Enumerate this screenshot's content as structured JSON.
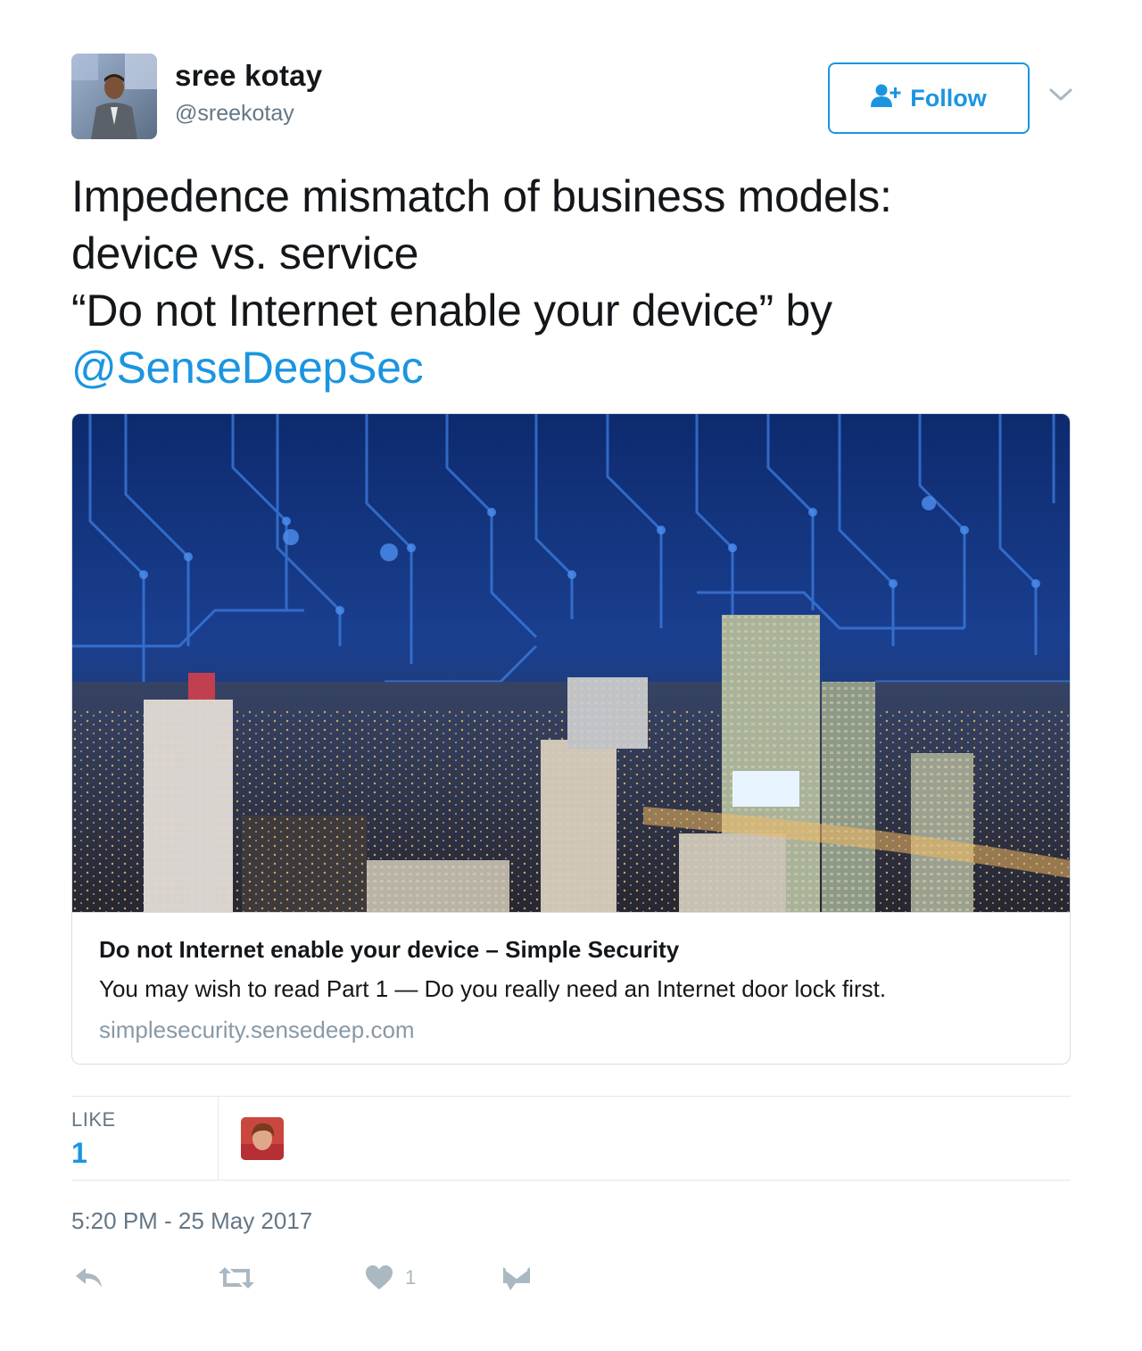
{
  "user": {
    "display_name": "sree kotay",
    "handle": "@sreekotay"
  },
  "follow_button": {
    "label": "Follow"
  },
  "tweet": {
    "lines": [
      "Impedence mismatch of business models:",
      "device vs. service",
      "“Do not Internet enable your device” by"
    ],
    "mention": "@SenseDeepSec"
  },
  "card": {
    "title": "Do not Internet enable your device – Simple Security",
    "description": "You may wish to read Part 1 — Do you really need an Internet door lock first.",
    "domain": "simplesecurity.sensedeep.com"
  },
  "stats": {
    "like_label": "LIKE",
    "like_count": "1"
  },
  "timestamp": "5:20 PM - 25 May 2017",
  "actions": {
    "like_count": "1"
  },
  "colors": {
    "accent": "#1b95e0",
    "text": "#14171a",
    "muted": "#657786",
    "icon": "#aab8c2",
    "border": "#e1e8ed"
  },
  "icons": [
    "follow-user-icon",
    "caret-down-icon",
    "reply-icon",
    "retweet-icon",
    "heart-icon",
    "direct-message-icon"
  ]
}
